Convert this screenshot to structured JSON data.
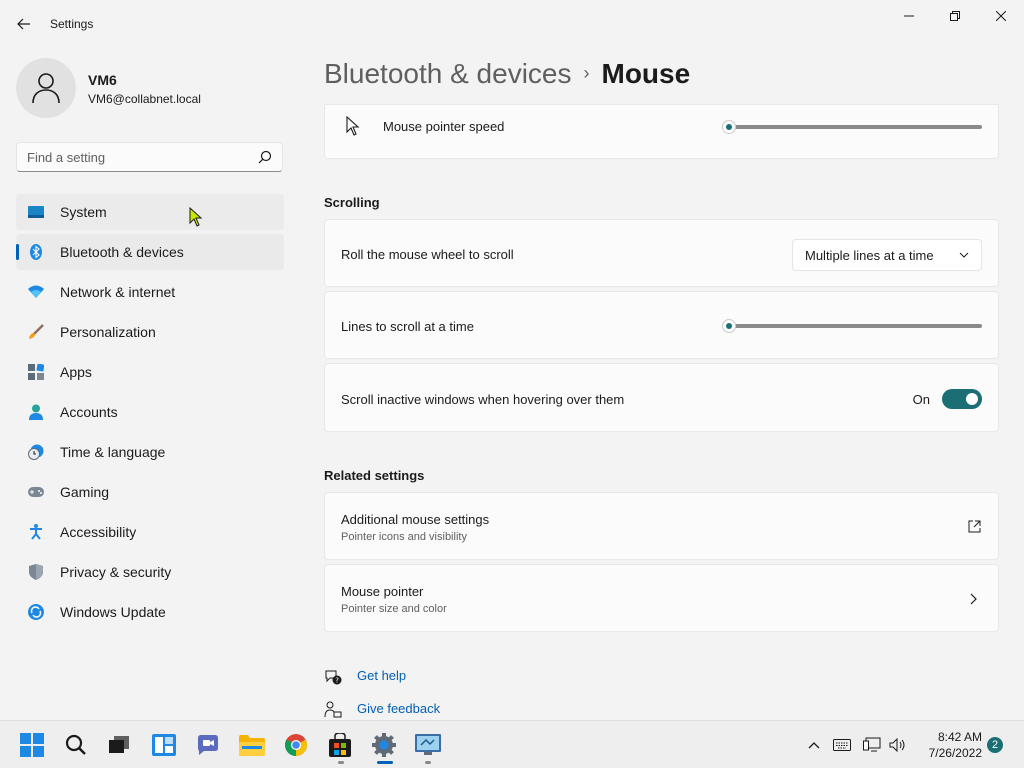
{
  "window": {
    "title": "Settings"
  },
  "profile": {
    "name": "VM6",
    "email": "VM6@collabnet.local"
  },
  "search": {
    "placeholder": "Find a setting"
  },
  "sidebar": {
    "items": [
      {
        "label": "System",
        "icon": "system-icon"
      },
      {
        "label": "Bluetooth & devices",
        "icon": "bluetooth-icon",
        "selected": true
      },
      {
        "label": "Network & internet",
        "icon": "wifi-icon"
      },
      {
        "label": "Personalization",
        "icon": "brush-icon"
      },
      {
        "label": "Apps",
        "icon": "apps-icon"
      },
      {
        "label": "Accounts",
        "icon": "person-icon"
      },
      {
        "label": "Time & language",
        "icon": "clock-globe-icon"
      },
      {
        "label": "Gaming",
        "icon": "gamepad-icon"
      },
      {
        "label": "Accessibility",
        "icon": "accessibility-icon"
      },
      {
        "label": "Privacy & security",
        "icon": "shield-icon"
      },
      {
        "label": "Windows Update",
        "icon": "update-icon"
      }
    ]
  },
  "breadcrumb": {
    "parent": "Bluetooth & devices",
    "separator": "›",
    "current": "Mouse"
  },
  "main": {
    "pointer_speed": {
      "label": "Mouse pointer speed",
      "value_fraction": 0.0
    },
    "scrolling_title": "Scrolling",
    "roll_wheel": {
      "label": "Roll the mouse wheel to scroll",
      "selected": "Multiple lines at a time"
    },
    "lines_to_scroll": {
      "label": "Lines to scroll at a time",
      "value_fraction": 0.0
    },
    "scroll_inactive": {
      "label": "Scroll inactive windows when hovering over them",
      "state": "On"
    },
    "related_title": "Related settings",
    "additional_mouse": {
      "label": "Additional mouse settings",
      "sub": "Pointer icons and visibility"
    },
    "mouse_pointer": {
      "label": "Mouse pointer",
      "sub": "Pointer size and color"
    },
    "get_help": "Get help",
    "give_feedback": "Give feedback"
  },
  "taskbar": {
    "time": "8:42 AM",
    "date": "7/26/2022",
    "notifications": "2"
  },
  "colors": {
    "accent": "#1a6e74",
    "selection_indicator": "#005fb8",
    "background": "#f3f3f3",
    "card": "#fbfbfb"
  }
}
